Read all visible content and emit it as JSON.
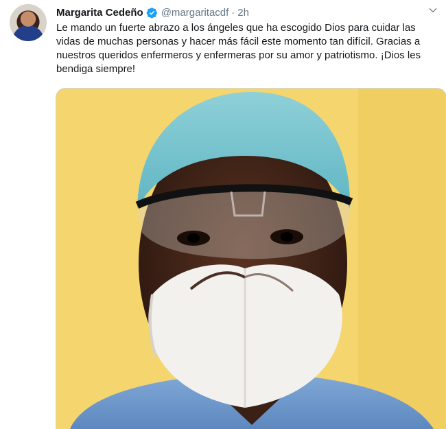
{
  "tweet": {
    "author_name": "Margarita Cedeño",
    "handle": "@margaritacdf",
    "separator": "·",
    "time": "2h",
    "text": "Le mando un fuerte abrazo a los ángeles que ha escogido Dios para cuidar las vidas de muchas personas y hacer más fácil este momento tan difícil. Gracias a nuestros queridos enfermeros y enfermeras por su amor y patriotismo. ¡Dios les bendiga siempre!"
  },
  "colors": {
    "verified_badge": "#1da1f2",
    "secondary_text": "#657786",
    "media_background": "#f4d46a"
  },
  "icons": [
    "verified-badge-icon",
    "chevron-down-icon"
  ]
}
